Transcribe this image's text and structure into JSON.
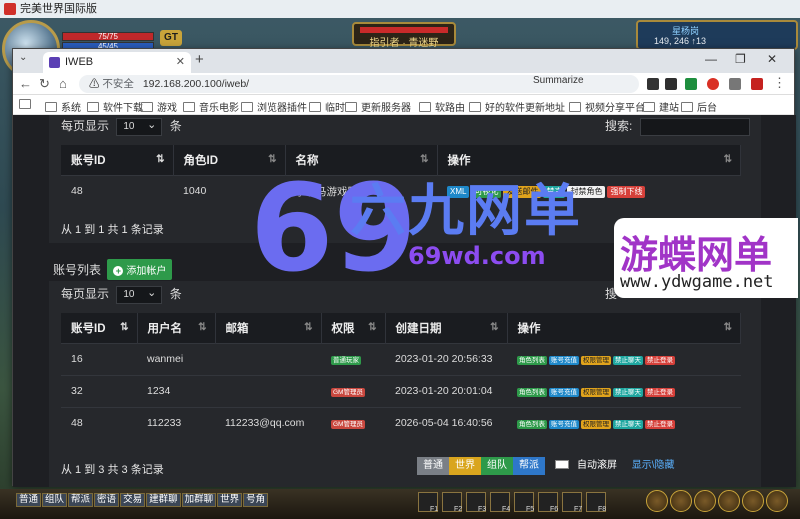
{
  "game": {
    "window_title": "完美世界国际版",
    "hp": "75/75",
    "mp": "45/45",
    "gt_label": "GT",
    "target_name": "指引者 · 青迷野",
    "map_name": "星杨岗",
    "coords": "149, 246 ↑13",
    "chat_channels": [
      "普通",
      "组队",
      "帮派",
      "密语",
      "交易",
      "建群聊",
      "加群聊",
      "世界",
      "号角"
    ],
    "fkeys": [
      "F1",
      "F2",
      "F3",
      "F4",
      "F5",
      "F6",
      "F7",
      "F8"
    ]
  },
  "browser": {
    "tab_title": "IWEB",
    "tab_close": "✕",
    "new_tab": "+",
    "window_minimize": "—",
    "window_restore": "❐",
    "window_close": "✕",
    "insecure_label": "不安全",
    "url": "192.168.200.100/iweb/",
    "summarize": "Summarize",
    "bookmarks": [
      "系统",
      "软件下载",
      "游戏",
      "音乐电影",
      "浏览器插件",
      "临时",
      "更新服务器",
      "软路由",
      "好的软件更新地址",
      "视频分享平台",
      "建站",
      "后台"
    ]
  },
  "roles": {
    "per_page_prefix": "每页显示",
    "per_page_value": "10",
    "per_page_suffix": "条",
    "search_label": "搜索:",
    "columns": [
      "账号ID",
      "角色ID",
      "名称",
      "操作"
    ],
    "rows": [
      {
        "account_id": "48",
        "role_id": "1040",
        "name": "攀攀马游戏网"
      }
    ],
    "actions": [
      "XML",
      "可视化",
      "发送邮件",
      "禁言",
      "封禁角色",
      "强制下线"
    ],
    "summary": "从 1 到 1 共 1 条记录"
  },
  "accounts": {
    "title": "账号列表",
    "add_button": "添加帐户",
    "per_page_prefix": "每页显示",
    "per_page_value": "10",
    "per_page_suffix": "条",
    "search_label": "搜",
    "columns": [
      "账号ID",
      "用户名",
      "邮箱",
      "权限",
      "创建日期",
      "操作"
    ],
    "rows": [
      {
        "id": "16",
        "username": "wanmei",
        "email": "",
        "role": "普通玩家",
        "created": "2023-01-20 20:56:33"
      },
      {
        "id": "32",
        "username": "1234",
        "email": "",
        "role": "GM管理员",
        "created": "2023-01-20 20:01:04"
      },
      {
        "id": "48",
        "username": "112233",
        "email": "112233@qq.com",
        "role": "GM管理员",
        "created": "2026-05-04 16:40:56"
      }
    ],
    "actions": [
      "角色列表",
      "账号充值",
      "权限管理",
      "禁止聊天",
      "禁止登录"
    ],
    "summary": "从 1 到 3 共 3 条记录"
  },
  "chat": {
    "tabs": [
      "普通",
      "世界",
      "组队",
      "帮派"
    ],
    "auto_scroll": "自动滚屏",
    "show_hide": "显示\\隐藏"
  },
  "watermarks": {
    "brand1_cn": "六九网单",
    "brand1_glyph": "69",
    "brand1_url": "69wd.com",
    "brand2_cn": "游蝶网单",
    "brand2_url": "www.ydwgame.net"
  }
}
